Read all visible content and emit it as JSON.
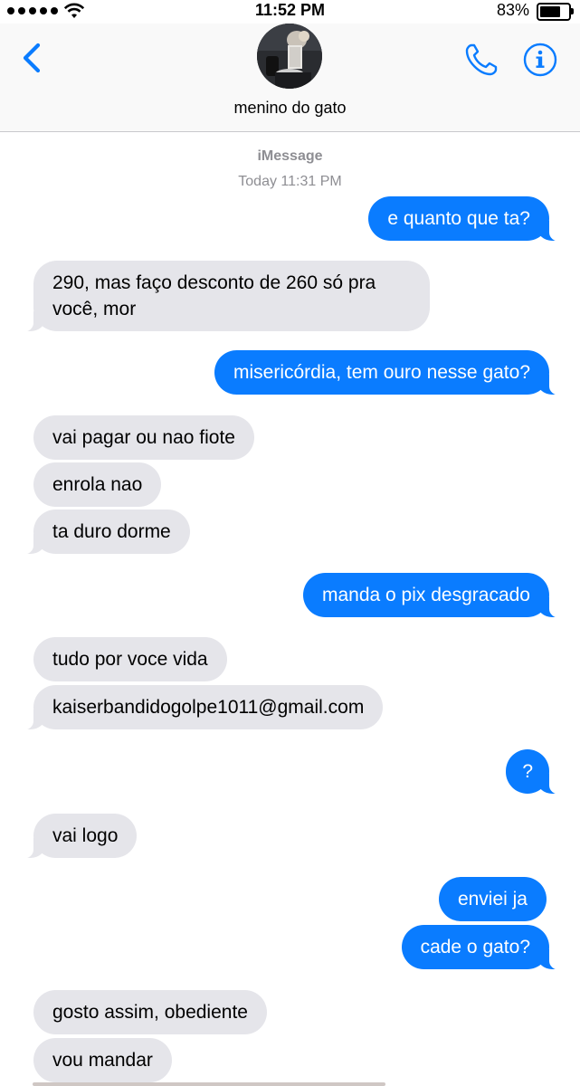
{
  "status_bar": {
    "time": "11:52 PM",
    "battery": "83%",
    "battery_level": 0.83
  },
  "header": {
    "back_icon": "chevron-left-icon",
    "contact_name": "menino do gato",
    "phone_icon": "phone-icon",
    "info_icon": "info-icon",
    "accent_color": "#0a7cff"
  },
  "thread": {
    "service_label": "iMessage",
    "timestamp": "Today 11:31 PM"
  },
  "messages": [
    {
      "from": "me",
      "text": "e quanto que ta?"
    },
    {
      "from": "them",
      "text": "290, mas faço desconto de 260 só pra você, mor"
    },
    {
      "from": "me",
      "text": "misericórdia, tem ouro nesse gato?"
    },
    {
      "from": "them",
      "text": "vai pagar ou nao fiote"
    },
    {
      "from": "them",
      "text": "enrola nao"
    },
    {
      "from": "them",
      "text": "ta duro dorme"
    },
    {
      "from": "me",
      "text": "manda o pix desgracado"
    },
    {
      "from": "them",
      "text": "tudo por voce vida"
    },
    {
      "from": "them",
      "text": "kaiserbandidogolpe1011@gmail.com"
    },
    {
      "from": "me",
      "text": "?"
    },
    {
      "from": "them",
      "text": "vai logo"
    },
    {
      "from": "me",
      "text": "enviei ja"
    },
    {
      "from": "me",
      "text": "cade o gato?"
    },
    {
      "from": "them",
      "text": "gosto assim, obediente"
    },
    {
      "from": "them",
      "text": "vou mandar"
    }
  ],
  "colors": {
    "sent_bubble": "#0a7cff",
    "received_bubble": "#e5e5ea",
    "secondary_text": "#8e8e93"
  }
}
